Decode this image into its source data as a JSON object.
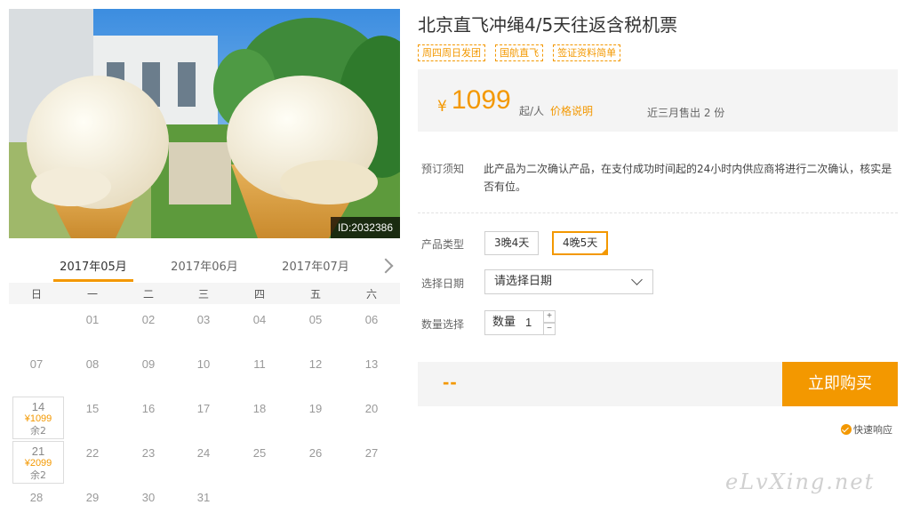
{
  "product": {
    "title": "北京直飞冲绳4/5天往返含税机票",
    "tags": [
      "周四周日发团",
      "国航直飞",
      "签证资料简单"
    ],
    "image_id": "ID:2032386"
  },
  "price": {
    "currency": "¥",
    "amount": "1099",
    "unit": "起/人",
    "info_link": "价格说明",
    "sold": "近三月售出 2 份"
  },
  "notice": {
    "label": "预订须知",
    "text": "此产品为二次确认产品，在支付成功时间起的24小时内供应商将进行二次确认，核实是否有位。"
  },
  "options": {
    "type_label": "产品类型",
    "types": [
      {
        "label": "3晚4天",
        "selected": false
      },
      {
        "label": "4晚5天",
        "selected": true
      }
    ],
    "date_label": "选择日期",
    "date_placeholder": "请选择日期",
    "qty_label": "数量选择",
    "qty_inner_label": "数量",
    "qty_value": "1",
    "qty_plus": "+",
    "qty_minus": "−"
  },
  "buy": {
    "total": "--",
    "button": "立即购买",
    "quick_response": "快速响应"
  },
  "calendar": {
    "months": [
      "2017年05月",
      "2017年06月",
      "2017年07月"
    ],
    "active_month": 0,
    "weekdays": [
      "日",
      "一",
      "二",
      "三",
      "四",
      "五",
      "六"
    ],
    "weeks": [
      [
        null,
        "01",
        "02",
        "03",
        "04",
        "05",
        "06"
      ],
      [
        "07",
        "08",
        "09",
        "10",
        "11",
        "12",
        "13"
      ],
      [
        "14",
        "15",
        "16",
        "17",
        "18",
        "19",
        "20"
      ],
      [
        "21",
        "22",
        "23",
        "24",
        "25",
        "26",
        "27"
      ],
      [
        "28",
        "29",
        "30",
        "31",
        null,
        null,
        null
      ]
    ],
    "available": {
      "14": {
        "price": "¥1099",
        "stock": "余2"
      },
      "21": {
        "price": "¥2099",
        "stock": "余2"
      }
    }
  },
  "watermark": "eLvXing.net",
  "colors": {
    "accent": "#f39800",
    "muted": "#999999",
    "panel": "#f4f4f4"
  }
}
